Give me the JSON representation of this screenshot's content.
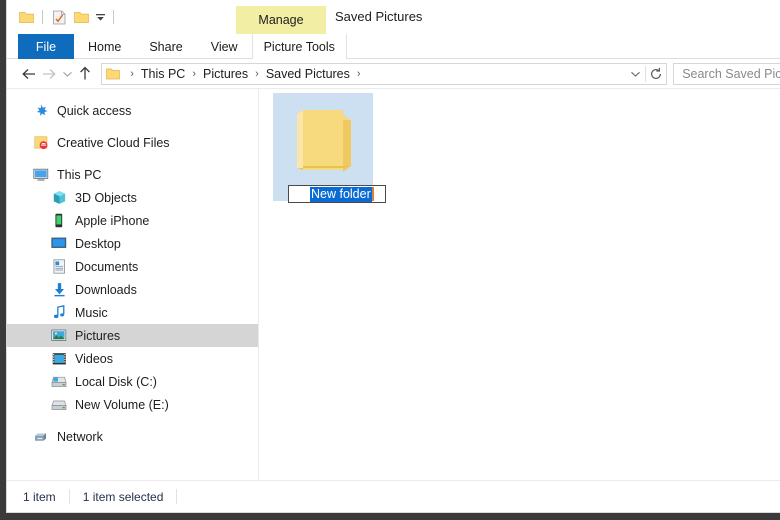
{
  "window": {
    "title": "Saved Pictures",
    "accent_blue": "#0f6cbd",
    "contextual_yellow": "#f2efa4",
    "selection_blue": "#0a6bd4"
  },
  "quick_access_toolbar": {
    "items": [
      {
        "name": "folder-icon",
        "tooltip": "Explorer"
      },
      {
        "name": "properties-icon",
        "tooltip": "Properties"
      },
      {
        "name": "new-folder-icon",
        "tooltip": "New folder"
      },
      {
        "name": "chevron-down-icon",
        "tooltip": "Customize Quick Access Toolbar"
      }
    ]
  },
  "contextual_tab_group": {
    "header_label": "Manage",
    "tab_label": "Picture Tools"
  },
  "ribbon": {
    "tabs": [
      {
        "label": "File",
        "selected": true
      },
      {
        "label": "Home",
        "selected": false
      },
      {
        "label": "Share",
        "selected": false
      },
      {
        "label": "View",
        "selected": false
      }
    ]
  },
  "navigation": {
    "back_label": "Back",
    "forward_label": "Forward",
    "recent_label": "Recent locations",
    "up_label": "Up",
    "breadcrumbs": [
      "This PC",
      "Pictures",
      "Saved Pictures"
    ],
    "separator": "›",
    "address_chevron": "chevron-down-icon",
    "refresh": "refresh-icon"
  },
  "search": {
    "placeholder": "Search Saved Pictures",
    "value": ""
  },
  "sidebar": {
    "items": [
      {
        "label": "Quick access",
        "icon": "star-icon",
        "level": 0,
        "selected": false
      },
      {
        "label": "Creative Cloud Files",
        "icon": "creative-cloud-icon",
        "level": 0,
        "selected": false
      },
      {
        "label": "This PC",
        "icon": "monitor-icon",
        "level": 0,
        "selected": false
      },
      {
        "label": "3D Objects",
        "icon": "cube-icon",
        "level": 1,
        "selected": false
      },
      {
        "label": "Apple iPhone",
        "icon": "phone-icon",
        "level": 1,
        "selected": false
      },
      {
        "label": "Desktop",
        "icon": "desktop-icon",
        "level": 1,
        "selected": false
      },
      {
        "label": "Documents",
        "icon": "documents-icon",
        "level": 1,
        "selected": false
      },
      {
        "label": "Downloads",
        "icon": "download-icon",
        "level": 1,
        "selected": false
      },
      {
        "label": "Music",
        "icon": "music-note-icon",
        "level": 1,
        "selected": false
      },
      {
        "label": "Pictures",
        "icon": "pictures-icon",
        "level": 1,
        "selected": true
      },
      {
        "label": "Videos",
        "icon": "videos-icon",
        "level": 1,
        "selected": false
      },
      {
        "label": "Local Disk (C:)",
        "icon": "local-disk-icon",
        "level": 1,
        "selected": false
      },
      {
        "label": "New Volume (E:)",
        "icon": "drive-icon",
        "level": 1,
        "selected": false
      },
      {
        "label": "Network",
        "icon": "network-icon",
        "level": 0,
        "selected": false
      }
    ]
  },
  "content": {
    "items": [
      {
        "name": "New folder",
        "icon": "folder-icon",
        "selected": true,
        "renaming": true,
        "rename_value": "New folder"
      }
    ]
  },
  "status_bar": {
    "item_count": "1 item",
    "selection_count": "1 item selected"
  }
}
